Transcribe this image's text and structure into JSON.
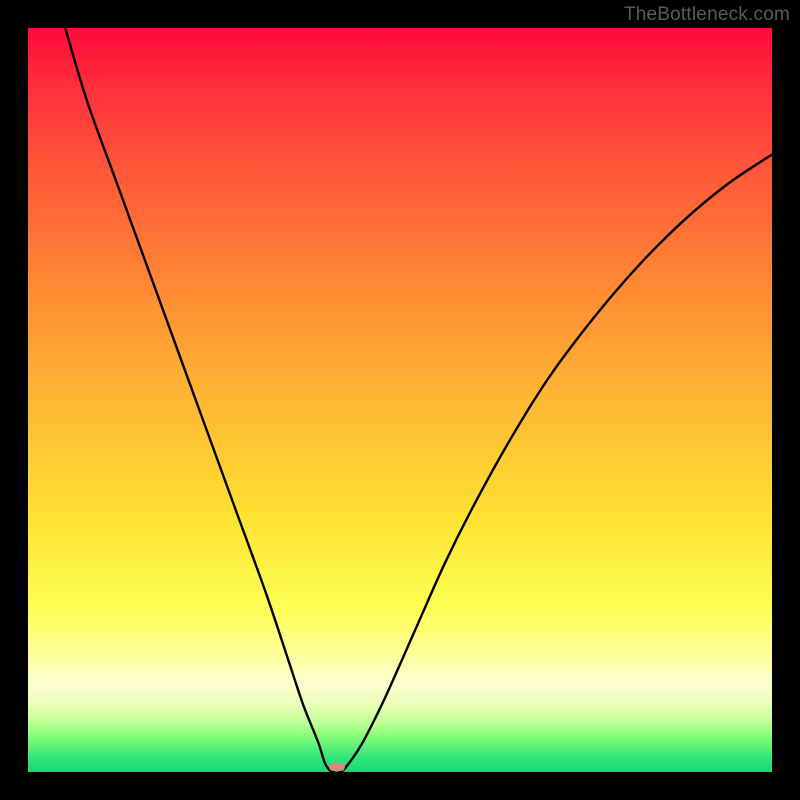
{
  "watermark": "TheBottleneck.com",
  "chart_data": {
    "type": "line",
    "title": "",
    "xlabel": "",
    "ylabel": "",
    "xlim": [
      0,
      100
    ],
    "ylim": [
      0,
      100
    ],
    "series": [
      {
        "name": "bottleneck-curve",
        "x": [
          5,
          8,
          12,
          16,
          20,
          24,
          28,
          32,
          35,
          37,
          39,
          40,
          41,
          42,
          43,
          45,
          48,
          52,
          56,
          60,
          65,
          70,
          76,
          82,
          88,
          94,
          100
        ],
        "y": [
          100,
          90,
          79,
          68,
          57,
          46,
          35,
          24,
          15,
          9,
          4,
          1,
          0,
          0,
          1,
          4,
          10,
          19,
          28,
          36,
          45,
          53,
          61,
          68,
          74,
          79,
          83
        ]
      }
    ],
    "minimum_point": {
      "x": 41.5,
      "y": 0
    },
    "gradient_bands": [
      {
        "color": "#ff0a3a",
        "label": "severe-bottleneck"
      },
      {
        "color": "#ffb733",
        "label": "moderate-bottleneck"
      },
      {
        "color": "#ffff55",
        "label": "mild-bottleneck"
      },
      {
        "color": "#18d870",
        "label": "no-bottleneck"
      }
    ]
  }
}
